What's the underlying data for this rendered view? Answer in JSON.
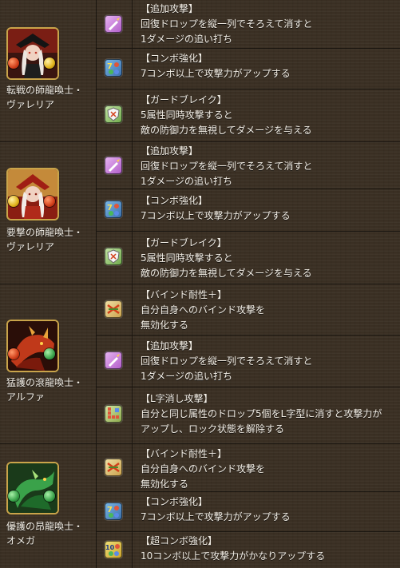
{
  "colors": {
    "background": "#3a2f23",
    "text": "#f3efe7",
    "divider": "#1c1711",
    "frame_gold": "#c9a44a",
    "orb_fire": "#d23f1a",
    "orb_light": "#e0b21a",
    "orb_wood": "#3aa24a"
  },
  "monsters": [
    {
      "name": "転戦の師龍喚士・\nヴァレリア",
      "attribute_icons": [
        "fire-orb-icon",
        "light-orb-icon"
      ],
      "skills": [
        {
          "icon": "extra-attack-icon",
          "title": "【追加攻撃】",
          "desc": "回復ドロップを縦一列でそろえて消すと\n1ダメージの追い打ち"
        },
        {
          "icon": "combo-boost-7-icon",
          "title": "【コンボ強化】",
          "desc": "7コンボ以上で攻撃力がアップする"
        },
        {
          "icon": "guard-break-icon",
          "title": "【ガードブレイク】",
          "desc": "5属性同時攻撃すると\n敵の防御力を無視してダメージを与える"
        }
      ]
    },
    {
      "name": "要撃の師龍喚士・\nヴァレリア",
      "attribute_icons": [
        "light-orb-icon",
        "fire-orb-icon"
      ],
      "skills": [
        {
          "icon": "extra-attack-icon",
          "title": "【追加攻撃】",
          "desc": "回復ドロップを縦一列でそろえて消すと\n1ダメージの追い打ち"
        },
        {
          "icon": "combo-boost-7-icon",
          "title": "【コンボ強化】",
          "desc": "7コンボ以上で攻撃力がアップする"
        },
        {
          "icon": "guard-break-icon",
          "title": "【ガードブレイク】",
          "desc": "5属性同時攻撃すると\n敵の防御力を無視してダメージを与える"
        }
      ]
    },
    {
      "name": "猛護の滾龍喚士・\nアルファ",
      "attribute_icons": [
        "fire-orb-icon",
        "wood-orb-icon"
      ],
      "skills": [
        {
          "icon": "bind-resist-icon",
          "title": "【バインド耐性＋】",
          "desc": "自分自身へのバインド攻撃を\n無効化する"
        },
        {
          "icon": "extra-attack-icon",
          "title": "【追加攻撃】",
          "desc": "回復ドロップを縦一列でそろえて消すと\n1ダメージの追い打ち"
        },
        {
          "icon": "l-shape-icon",
          "title": "【L字消し攻撃】",
          "desc": "自分と同じ属性のドロップ5個をL字型に消すと攻撃力が\nアップし、ロック状態を解除する"
        }
      ]
    },
    {
      "name": "優護の昂龍喚士・\nオメガ",
      "attribute_icons": [
        "wood-orb-icon",
        "wood-orb-icon"
      ],
      "skills": [
        {
          "icon": "bind-resist-icon",
          "title": "【バインド耐性＋】",
          "desc": "自分自身へのバインド攻撃を\n無効化する"
        },
        {
          "icon": "combo-boost-7-icon",
          "title": "【コンボ強化】",
          "desc": "7コンボ以上で攻撃力がアップする"
        },
        {
          "icon": "super-combo-10-icon",
          "title": "【超コンボ強化】",
          "desc": "10コンボ以上で攻撃力がかなりアップする"
        }
      ]
    }
  ]
}
